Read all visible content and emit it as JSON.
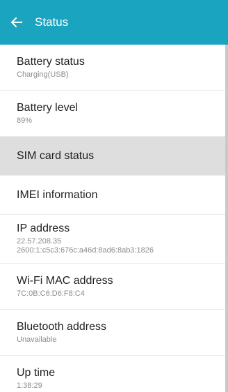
{
  "header": {
    "title": "Status"
  },
  "items": [
    {
      "title": "Battery status",
      "sub": "Charging(USB)"
    },
    {
      "title": "Battery level",
      "sub": "89%"
    },
    {
      "title": "SIM card status"
    },
    {
      "title": "IMEI information"
    },
    {
      "title": "IP address",
      "sub": "22.57.208.35\n2600:1:c5c3:676c:a46d:8ad6:8ab3:1826"
    },
    {
      "title": "Wi-Fi MAC address",
      "sub": "7C:0B:C6:D6:F8:C4"
    },
    {
      "title": "Bluetooth address",
      "sub": "Unavailable"
    },
    {
      "title": "Up time",
      "sub": "1:38:29"
    }
  ],
  "colors": {
    "app_bar": "#1aa4bf",
    "selected_row": "#dedede"
  },
  "icons": {
    "back": "arrow-back-icon"
  }
}
